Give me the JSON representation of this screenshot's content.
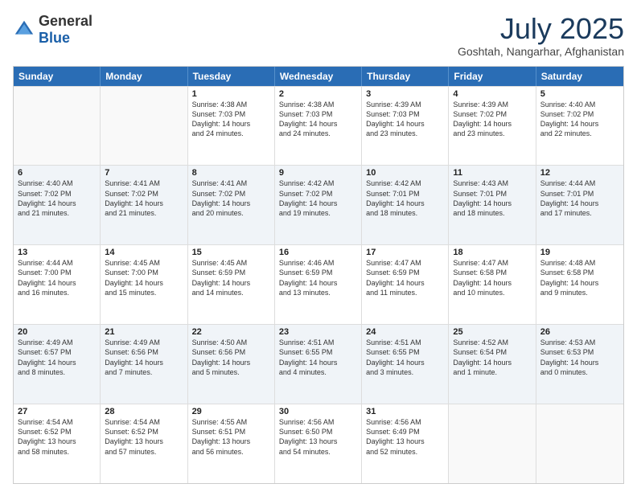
{
  "header": {
    "logo_general": "General",
    "logo_blue": "Blue",
    "month_title": "July 2025",
    "location": "Goshtah, Nangarhar, Afghanistan"
  },
  "calendar": {
    "days_of_week": [
      "Sunday",
      "Monday",
      "Tuesday",
      "Wednesday",
      "Thursday",
      "Friday",
      "Saturday"
    ],
    "rows": [
      [
        {
          "day": "",
          "lines": [],
          "empty": true
        },
        {
          "day": "",
          "lines": [],
          "empty": true
        },
        {
          "day": "1",
          "lines": [
            "Sunrise: 4:38 AM",
            "Sunset: 7:03 PM",
            "Daylight: 14 hours",
            "and 24 minutes."
          ],
          "empty": false
        },
        {
          "day": "2",
          "lines": [
            "Sunrise: 4:38 AM",
            "Sunset: 7:03 PM",
            "Daylight: 14 hours",
            "and 24 minutes."
          ],
          "empty": false
        },
        {
          "day": "3",
          "lines": [
            "Sunrise: 4:39 AM",
            "Sunset: 7:03 PM",
            "Daylight: 14 hours",
            "and 23 minutes."
          ],
          "empty": false
        },
        {
          "day": "4",
          "lines": [
            "Sunrise: 4:39 AM",
            "Sunset: 7:02 PM",
            "Daylight: 14 hours",
            "and 23 minutes."
          ],
          "empty": false
        },
        {
          "day": "5",
          "lines": [
            "Sunrise: 4:40 AM",
            "Sunset: 7:02 PM",
            "Daylight: 14 hours",
            "and 22 minutes."
          ],
          "empty": false
        }
      ],
      [
        {
          "day": "6",
          "lines": [
            "Sunrise: 4:40 AM",
            "Sunset: 7:02 PM",
            "Daylight: 14 hours",
            "and 21 minutes."
          ],
          "empty": false
        },
        {
          "day": "7",
          "lines": [
            "Sunrise: 4:41 AM",
            "Sunset: 7:02 PM",
            "Daylight: 14 hours",
            "and 21 minutes."
          ],
          "empty": false
        },
        {
          "day": "8",
          "lines": [
            "Sunrise: 4:41 AM",
            "Sunset: 7:02 PM",
            "Daylight: 14 hours",
            "and 20 minutes."
          ],
          "empty": false
        },
        {
          "day": "9",
          "lines": [
            "Sunrise: 4:42 AM",
            "Sunset: 7:02 PM",
            "Daylight: 14 hours",
            "and 19 minutes."
          ],
          "empty": false
        },
        {
          "day": "10",
          "lines": [
            "Sunrise: 4:42 AM",
            "Sunset: 7:01 PM",
            "Daylight: 14 hours",
            "and 18 minutes."
          ],
          "empty": false
        },
        {
          "day": "11",
          "lines": [
            "Sunrise: 4:43 AM",
            "Sunset: 7:01 PM",
            "Daylight: 14 hours",
            "and 18 minutes."
          ],
          "empty": false
        },
        {
          "day": "12",
          "lines": [
            "Sunrise: 4:44 AM",
            "Sunset: 7:01 PM",
            "Daylight: 14 hours",
            "and 17 minutes."
          ],
          "empty": false
        }
      ],
      [
        {
          "day": "13",
          "lines": [
            "Sunrise: 4:44 AM",
            "Sunset: 7:00 PM",
            "Daylight: 14 hours",
            "and 16 minutes."
          ],
          "empty": false
        },
        {
          "day": "14",
          "lines": [
            "Sunrise: 4:45 AM",
            "Sunset: 7:00 PM",
            "Daylight: 14 hours",
            "and 15 minutes."
          ],
          "empty": false
        },
        {
          "day": "15",
          "lines": [
            "Sunrise: 4:45 AM",
            "Sunset: 6:59 PM",
            "Daylight: 14 hours",
            "and 14 minutes."
          ],
          "empty": false
        },
        {
          "day": "16",
          "lines": [
            "Sunrise: 4:46 AM",
            "Sunset: 6:59 PM",
            "Daylight: 14 hours",
            "and 13 minutes."
          ],
          "empty": false
        },
        {
          "day": "17",
          "lines": [
            "Sunrise: 4:47 AM",
            "Sunset: 6:59 PM",
            "Daylight: 14 hours",
            "and 11 minutes."
          ],
          "empty": false
        },
        {
          "day": "18",
          "lines": [
            "Sunrise: 4:47 AM",
            "Sunset: 6:58 PM",
            "Daylight: 14 hours",
            "and 10 minutes."
          ],
          "empty": false
        },
        {
          "day": "19",
          "lines": [
            "Sunrise: 4:48 AM",
            "Sunset: 6:58 PM",
            "Daylight: 14 hours",
            "and 9 minutes."
          ],
          "empty": false
        }
      ],
      [
        {
          "day": "20",
          "lines": [
            "Sunrise: 4:49 AM",
            "Sunset: 6:57 PM",
            "Daylight: 14 hours",
            "and 8 minutes."
          ],
          "empty": false
        },
        {
          "day": "21",
          "lines": [
            "Sunrise: 4:49 AM",
            "Sunset: 6:56 PM",
            "Daylight: 14 hours",
            "and 7 minutes."
          ],
          "empty": false
        },
        {
          "day": "22",
          "lines": [
            "Sunrise: 4:50 AM",
            "Sunset: 6:56 PM",
            "Daylight: 14 hours",
            "and 5 minutes."
          ],
          "empty": false
        },
        {
          "day": "23",
          "lines": [
            "Sunrise: 4:51 AM",
            "Sunset: 6:55 PM",
            "Daylight: 14 hours",
            "and 4 minutes."
          ],
          "empty": false
        },
        {
          "day": "24",
          "lines": [
            "Sunrise: 4:51 AM",
            "Sunset: 6:55 PM",
            "Daylight: 14 hours",
            "and 3 minutes."
          ],
          "empty": false
        },
        {
          "day": "25",
          "lines": [
            "Sunrise: 4:52 AM",
            "Sunset: 6:54 PM",
            "Daylight: 14 hours",
            "and 1 minute."
          ],
          "empty": false
        },
        {
          "day": "26",
          "lines": [
            "Sunrise: 4:53 AM",
            "Sunset: 6:53 PM",
            "Daylight: 14 hours",
            "and 0 minutes."
          ],
          "empty": false
        }
      ],
      [
        {
          "day": "27",
          "lines": [
            "Sunrise: 4:54 AM",
            "Sunset: 6:52 PM",
            "Daylight: 13 hours",
            "and 58 minutes."
          ],
          "empty": false
        },
        {
          "day": "28",
          "lines": [
            "Sunrise: 4:54 AM",
            "Sunset: 6:52 PM",
            "Daylight: 13 hours",
            "and 57 minutes."
          ],
          "empty": false
        },
        {
          "day": "29",
          "lines": [
            "Sunrise: 4:55 AM",
            "Sunset: 6:51 PM",
            "Daylight: 13 hours",
            "and 56 minutes."
          ],
          "empty": false
        },
        {
          "day": "30",
          "lines": [
            "Sunrise: 4:56 AM",
            "Sunset: 6:50 PM",
            "Daylight: 13 hours",
            "and 54 minutes."
          ],
          "empty": false
        },
        {
          "day": "31",
          "lines": [
            "Sunrise: 4:56 AM",
            "Sunset: 6:49 PM",
            "Daylight: 13 hours",
            "and 52 minutes."
          ],
          "empty": false
        },
        {
          "day": "",
          "lines": [],
          "empty": true
        },
        {
          "day": "",
          "lines": [],
          "empty": true
        }
      ]
    ]
  }
}
